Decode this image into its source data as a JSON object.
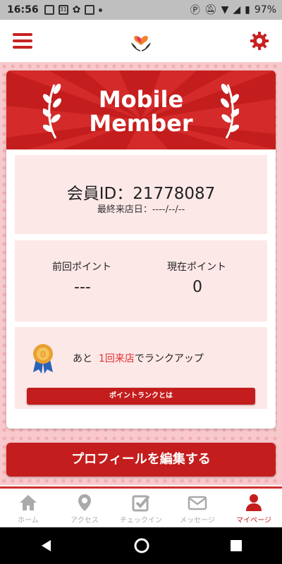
{
  "status_bar": {
    "time": "16:56",
    "calendar_day": "31",
    "battery": "97%"
  },
  "header": {
    "menu_icon": "hamburger-icon",
    "logo": "hands-heart-logo",
    "settings_icon": "gear-icon"
  },
  "card": {
    "title_line1": "Mobile",
    "title_line2": "Member",
    "member_id_label": "会員ID：21778087",
    "last_visit": "最終来店日：----/--/--",
    "points": {
      "previous_label": "前回ポイント",
      "previous_value": "---",
      "current_label": "現在ポイント",
      "current_value": "0"
    },
    "rank": {
      "prefix": "あと",
      "highlight": "1回来店",
      "suffix": "でランクアップ",
      "button_label": "ポイントランクとは"
    }
  },
  "edit_profile_button": "プロフィールを編集する",
  "tabs": [
    {
      "label": "ホーム",
      "icon": "home-icon",
      "active": false
    },
    {
      "label": "アクセス",
      "icon": "map-pin-icon",
      "active": false
    },
    {
      "label": "チェックイン",
      "icon": "checkbox-icon",
      "active": false
    },
    {
      "label": "メッセージ",
      "icon": "mail-icon",
      "active": false
    },
    {
      "label": "マイページ",
      "icon": "user-icon",
      "active": true
    }
  ],
  "colors": {
    "primary": "#c41d1d",
    "panel_bg": "#fde8e8",
    "inactive_tab": "#aaaaaa"
  }
}
